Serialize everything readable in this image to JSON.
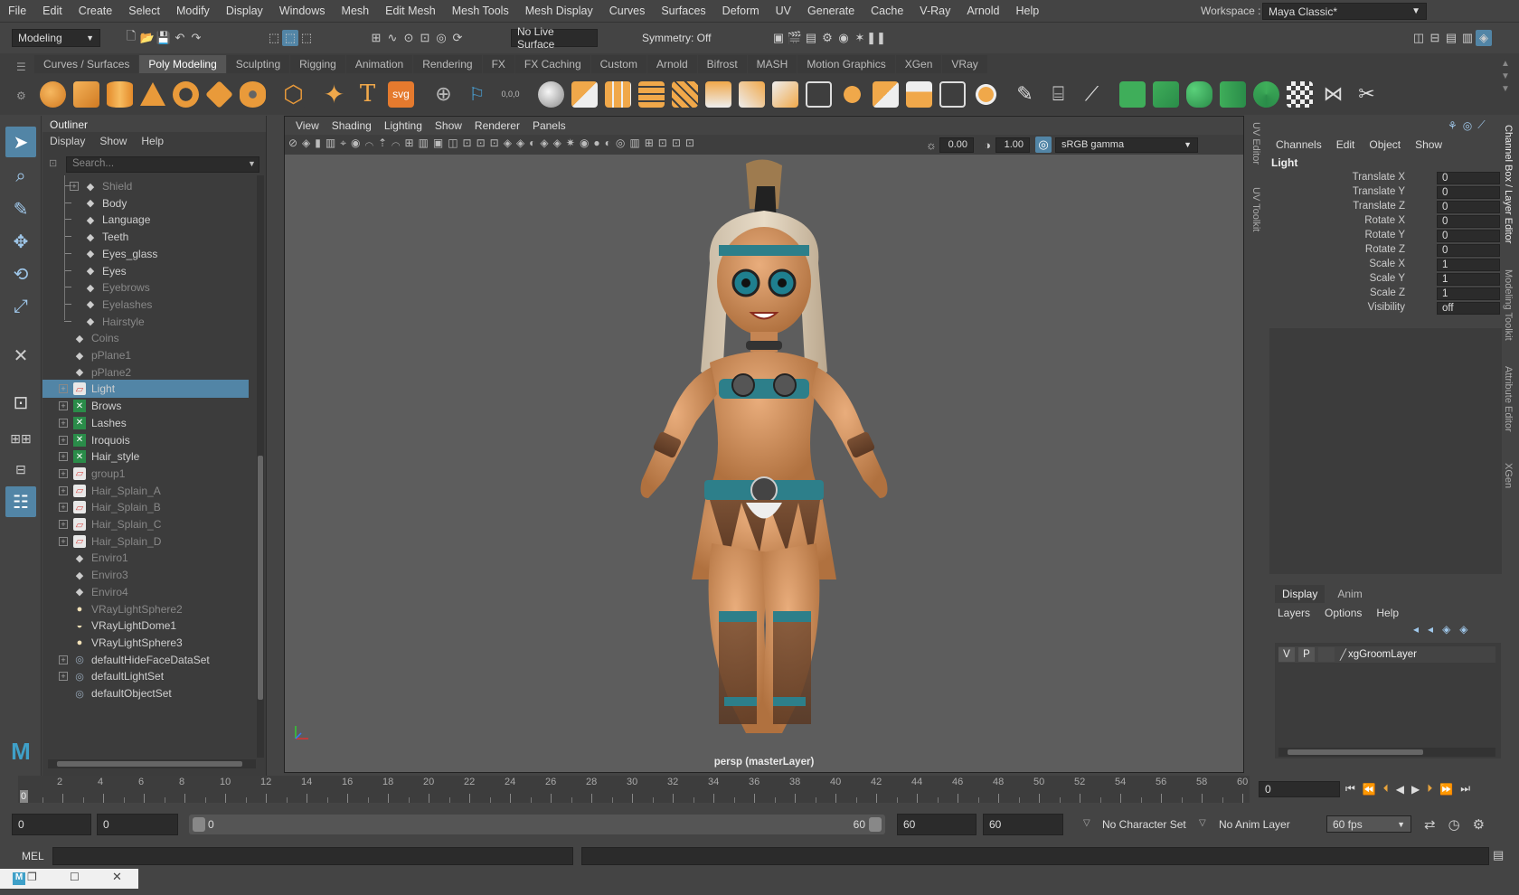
{
  "menubar": {
    "items": [
      "File",
      "Edit",
      "Create",
      "Select",
      "Modify",
      "Display",
      "Windows",
      "Mesh",
      "Edit Mesh",
      "Mesh Tools",
      "Mesh Display",
      "Curves",
      "Surfaces",
      "Deform",
      "UV",
      "Generate",
      "Cache",
      "V-Ray",
      "Arnold",
      "Help"
    ],
    "workspace_label": "Workspace :",
    "workspace_value": "Maya Classic*"
  },
  "status": {
    "mode": "Modeling",
    "live_surface": "No Live Surface",
    "symmetry": "Symmetry: Off"
  },
  "shelf": {
    "tabs": [
      "Curves / Surfaces",
      "Poly Modeling",
      "Sculpting",
      "Rigging",
      "Animation",
      "Rendering",
      "FX",
      "FX Caching",
      "Custom",
      "Arnold",
      "Bifrost",
      "MASH",
      "Motion Graphics",
      "XGen",
      "VRay"
    ],
    "active": "Poly Modeling",
    "svg_icon_label": "svg",
    "coords_icon_label": "0,0,0"
  },
  "outliner": {
    "title": "Outliner",
    "menus": [
      "Display",
      "Show",
      "Help"
    ],
    "search_placeholder": "Search...",
    "items": [
      {
        "label": "Shield",
        "indent": 2,
        "icon": "mesh",
        "expand": "+",
        "dim": true
      },
      {
        "label": "Body",
        "indent": 2,
        "icon": "mesh",
        "dim": false
      },
      {
        "label": "Language",
        "indent": 2,
        "icon": "mesh",
        "dim": false
      },
      {
        "label": "Teeth",
        "indent": 2,
        "icon": "mesh",
        "dim": false
      },
      {
        "label": "Eyes_glass",
        "indent": 2,
        "icon": "mesh",
        "dim": false
      },
      {
        "label": "Eyes",
        "indent": 2,
        "icon": "mesh",
        "dim": false
      },
      {
        "label": "Eyebrows",
        "indent": 2,
        "icon": "mesh",
        "dim": true
      },
      {
        "label": "Eyelashes",
        "indent": 2,
        "icon": "mesh",
        "dim": true
      },
      {
        "label": "Hairstyle",
        "indent": 2,
        "icon": "mesh",
        "dim": true
      },
      {
        "label": "Coins",
        "indent": 1,
        "icon": "mesh",
        "dim": true
      },
      {
        "label": "pPlane1",
        "indent": 1,
        "icon": "mesh",
        "dim": true
      },
      {
        "label": "pPlane2",
        "indent": 1,
        "icon": "mesh",
        "dim": true
      },
      {
        "label": "Light",
        "indent": 1,
        "icon": "group",
        "expand": "+",
        "sel": true
      },
      {
        "label": "Brows",
        "indent": 1,
        "icon": "xgen",
        "expand": "+"
      },
      {
        "label": "Lashes",
        "indent": 1,
        "icon": "xgen",
        "expand": "+"
      },
      {
        "label": "Iroquois",
        "indent": 1,
        "icon": "xgen",
        "expand": "+"
      },
      {
        "label": "Hair_style",
        "indent": 1,
        "icon": "xgen",
        "expand": "+"
      },
      {
        "label": "group1",
        "indent": 1,
        "icon": "group",
        "expand": "+",
        "dim": true
      },
      {
        "label": "Hair_Splain_A",
        "indent": 1,
        "icon": "group",
        "expand": "+",
        "dim": true
      },
      {
        "label": "Hair_Splain_B",
        "indent": 1,
        "icon": "group",
        "expand": "+",
        "dim": true
      },
      {
        "label": "Hair_Splain_C",
        "indent": 1,
        "icon": "group",
        "expand": "+",
        "dim": true
      },
      {
        "label": "Hair_Splain_D",
        "indent": 1,
        "icon": "group",
        "expand": "+",
        "dim": true
      },
      {
        "label": "Enviro1",
        "indent": 1,
        "icon": "mesh",
        "dim": true
      },
      {
        "label": "Enviro3",
        "indent": 1,
        "icon": "mesh",
        "dim": true
      },
      {
        "label": "Enviro4",
        "indent": 1,
        "icon": "mesh",
        "dim": true
      },
      {
        "label": "VRayLightSphere2",
        "indent": 1,
        "icon": "sphere",
        "dim": true
      },
      {
        "label": "VRayLightDome1",
        "indent": 1,
        "icon": "dome",
        "dim": false
      },
      {
        "label": "VRayLightSphere3",
        "indent": 1,
        "icon": "sphere",
        "dim": false
      },
      {
        "label": "defaultHideFaceDataSet",
        "indent": 1,
        "icon": "set",
        "expand": "+"
      },
      {
        "label": "defaultLightSet",
        "indent": 1,
        "icon": "set",
        "expand": "+"
      },
      {
        "label": "defaultObjectSet",
        "indent": 1,
        "icon": "set"
      }
    ]
  },
  "viewport": {
    "menus": [
      "View",
      "Shading",
      "Lighting",
      "Show",
      "Renderer",
      "Panels"
    ],
    "exposure": "0.00",
    "gamma": "1.00",
    "colorspace": "sRGB gamma",
    "camera_label": "persp (masterLayer)"
  },
  "side_tabs_left": [
    "UV Editor",
    "UV Toolkit"
  ],
  "side_tabs_right": [
    "Channel Box / Layer Editor",
    "Modeling Toolkit",
    "Attribute Editor",
    "XGen"
  ],
  "channelbox": {
    "menus": [
      "Channels",
      "Edit",
      "Object",
      "Show"
    ],
    "object": "Light",
    "attributes": [
      {
        "name": "Translate X",
        "value": "0"
      },
      {
        "name": "Translate Y",
        "value": "0"
      },
      {
        "name": "Translate Z",
        "value": "0"
      },
      {
        "name": "Rotate X",
        "value": "0"
      },
      {
        "name": "Rotate Y",
        "value": "0"
      },
      {
        "name": "Rotate Z",
        "value": "0"
      },
      {
        "name": "Scale X",
        "value": "1"
      },
      {
        "name": "Scale Y",
        "value": "1"
      },
      {
        "name": "Scale Z",
        "value": "1"
      },
      {
        "name": "Visibility",
        "value": "off"
      }
    ]
  },
  "layers": {
    "tabs": [
      "Display",
      "Anim"
    ],
    "active": "Display",
    "menus": [
      "Layers",
      "Options",
      "Help"
    ],
    "layer": {
      "v": "V",
      "p": "P",
      "name": "xgGroomLayer"
    }
  },
  "timeline": {
    "ticks": [
      "0",
      "2",
      "4",
      "6",
      "8",
      "10",
      "12",
      "14",
      "16",
      "18",
      "20",
      "22",
      "24",
      "26",
      "28",
      "30",
      "32",
      "34",
      "36",
      "38",
      "40",
      "42",
      "44",
      "46",
      "48",
      "50",
      "52",
      "54",
      "56",
      "58",
      "60"
    ],
    "current_frame": "0",
    "current_frame_marker": "0"
  },
  "range": {
    "start": "0",
    "anim_start": "0",
    "slider_start": "0",
    "slider_end": "60",
    "anim_end": "60",
    "end": "60",
    "character_set": "No Character Set",
    "anim_layer": "No Anim Layer",
    "fps": "60 fps"
  },
  "cmd": {
    "label": "MEL"
  },
  "colors": {
    "accent": "#5285a6",
    "orange": "#e8a33c",
    "xgen_green": "#3fae5a"
  }
}
